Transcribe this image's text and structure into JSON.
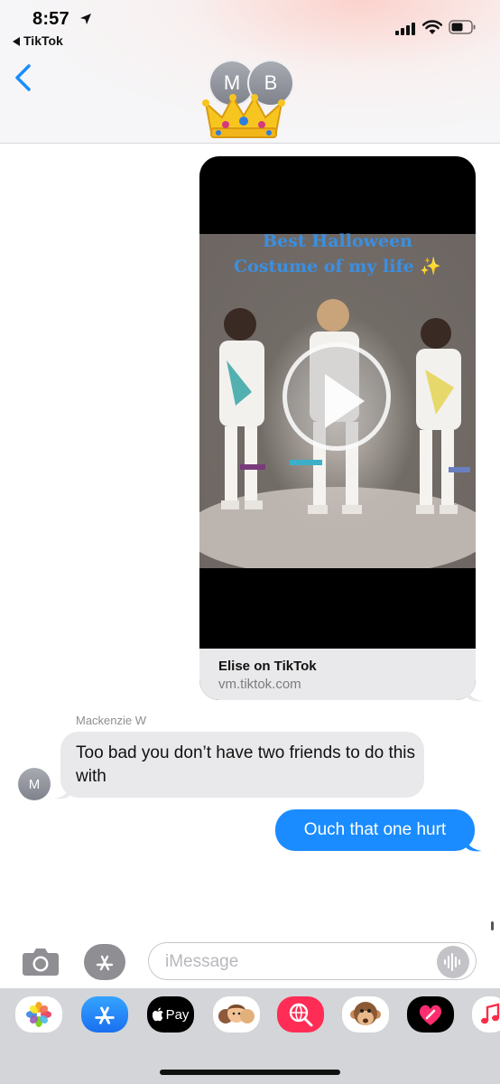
{
  "status_bar": {
    "time": "8:57",
    "back_app": "TikTok"
  },
  "header": {
    "avatar_initials": [
      "M",
      "B"
    ],
    "crown_icon": "crown-emoji"
  },
  "link_preview": {
    "video_caption_line1": "Best Halloween",
    "video_caption_line2": "Costume of my life ✨",
    "title": "Elise on TikTok",
    "domain": "vm.tiktok.com"
  },
  "messages": {
    "received": {
      "sender": "Mackenzie W",
      "sender_initial": "M",
      "text": "Too bad you don’t have two friends to do this with"
    },
    "sent": {
      "text": "Ouch that one hurt"
    }
  },
  "composer": {
    "placeholder": "iMessage"
  },
  "app_strip": {
    "apps": [
      "photos-icon",
      "app-store-icon",
      "apple-pay-icon",
      "memoji-icon",
      "web-search-icon",
      "monkey-emoji-icon",
      "digital-touch-icon",
      "music-icon"
    ],
    "apple_pay_label": "Pay"
  },
  "colors": {
    "sent_bubble": "#1a8cff",
    "received_bubble": "#e9e9eb",
    "caption_text": "#3b8fe0"
  }
}
